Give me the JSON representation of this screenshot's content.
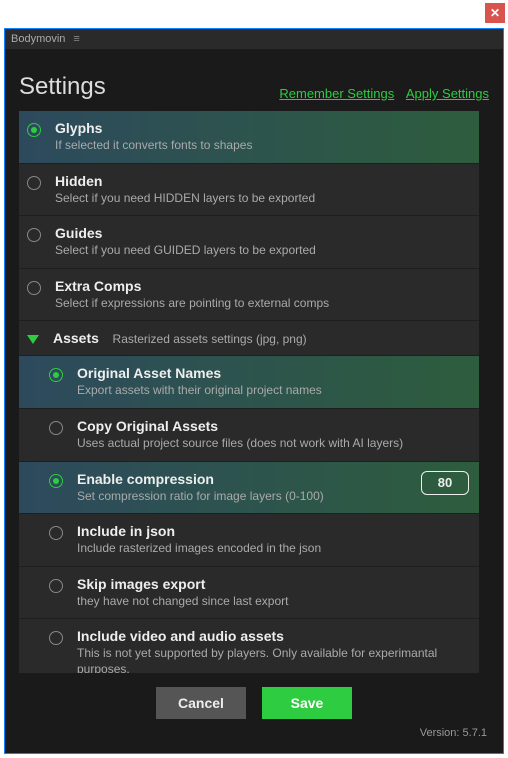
{
  "app_title": "Bodymovin",
  "header": {
    "title": "Settings",
    "remember": "Remember Settings",
    "apply": "Apply Settings"
  },
  "items": {
    "glyphs": {
      "name": "Glyphs",
      "desc": "If selected it converts fonts to shapes"
    },
    "hidden": {
      "name": "Hidden",
      "desc": "Select if you need HIDDEN layers to be exported"
    },
    "guides": {
      "name": "Guides",
      "desc": "Select if you need GUIDED layers to be exported"
    },
    "extra": {
      "name": "Extra Comps",
      "desc": "Select if expressions are pointing to external comps"
    },
    "assets": {
      "name": "Assets",
      "desc": "Rasterized assets settings (jpg, png)"
    },
    "orig": {
      "name": "Original Asset Names",
      "desc": "Export assets with their original project names"
    },
    "copy": {
      "name": "Copy Original Assets",
      "desc": "Uses actual project source files (does not work with AI layers)"
    },
    "comp": {
      "name": "Enable compression",
      "desc": "Set compression ratio for image layers (0-100)",
      "value": "80"
    },
    "json": {
      "name": "Include in json",
      "desc": "Include rasterized images encoded in the json"
    },
    "skip": {
      "name": "Skip images export",
      "desc": "they have not changed since last export"
    },
    "video": {
      "name": "Include video and audio assets",
      "desc": "This is not yet supported by players. Only available for experimantal purposes."
    }
  },
  "buttons": {
    "cancel": "Cancel",
    "save": "Save"
  },
  "version": "Version: 5.7.1"
}
